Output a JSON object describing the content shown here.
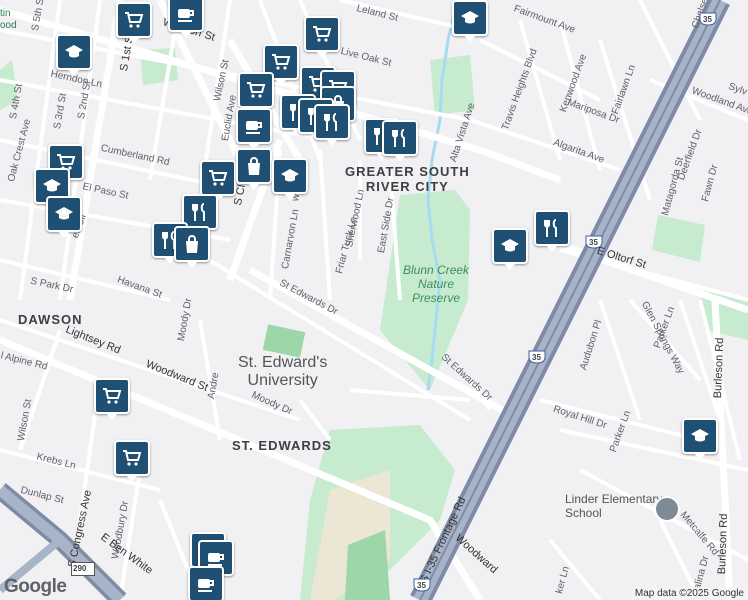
{
  "colors": {
    "land": "#f1f0f3",
    "park": "#c6ebcf",
    "water": "#a6dbf1",
    "road": "#ffffff",
    "highway": "#7d8ba6",
    "marker": "#1f4f72"
  },
  "areas": {
    "greater_south_river_city": "GREATER SOUTH\nRIVER CITY",
    "dawson": "DAWSON",
    "st_edwards": "ST. EDWARDS"
  },
  "park": "Blunn Creek\nNature\nPreserve",
  "university": "St. Edward's\nUniversity",
  "school": "Linder Elementary\nSchool",
  "partial_top_left": "tin\nood",
  "streets": {
    "w_oltorf": "W Oltorf St",
    "e_oltorf": "E Oltorf St",
    "s_1st": "S 1st St",
    "s_5th": "S 5th St",
    "s_4th": "S 4th St",
    "s_3rd": "S 3rd St",
    "s_2nd": "S 2nd St",
    "herndon": "Herndon Ln",
    "oak_crest": "Oak Crest Ave",
    "cumberland": "Cumberland Rd",
    "el_paso": "El Paso St",
    "wilson_top": "Wilson St",
    "euclid": "Euclid Ave",
    "leland": "Leland St",
    "live_oak": "Live Oak St",
    "fairmount": "Fairmount Ave",
    "travis_heights": "Travis Heights Blvd",
    "kenwood": "Kenwood Ave",
    "fairlawn": "Fairlawn Ln",
    "mariposa": "Mariposa Dr",
    "algarita": "Algarita Ave",
    "alta_vista": "Alta Vista Ave",
    "chelsea": "Chelse",
    "woodland": "Woodland Ave",
    "sylvan": "Sylv",
    "deerfield": "Deerfield Dr",
    "matagorda": "Matagorda St",
    "fawn": "Fawn Dr",
    "sherwood": "Sherwood Ln",
    "carnarvon": "Carnarvon Ln",
    "friar_tuck": "Friar Tuck Ln",
    "east_side": "East Side Dr",
    "st_edwards_dr": "St Edwards Dr",
    "st_edwards_dr2": "St Edwards Dr",
    "havana": "Havana St",
    "s_park": "S Park Dr",
    "lightsey": "Lightsey Rd",
    "woodward": "Woodward St",
    "alpine": "l Alpine Rd",
    "moody": "Moody Dr",
    "moody2": "Moody Dr",
    "andre": "Andre",
    "wilson": "Wilson St",
    "krebs": "Krebs Ln",
    "dunlap": "Dunlap St",
    "s_congress": "S Congress Ave",
    "woodbury": "Woodbury Dr",
    "ben_white": "E Ben White",
    "audubon": "Audubon Pl",
    "parker": "Parker Ln",
    "parker2": "Parker Ln",
    "glen_springs": "Glen Springs Way",
    "royal_hill": "Royal Hill Dr",
    "burleson": "Burleson Rd",
    "burleson2": "Burleson Rd",
    "frontage": "S I-35 Frontage Rd",
    "woodward2": "Woodward",
    "metcalfe": "Metcalfe Rd",
    "catalina": "alina Dr",
    "ker": "ker Ln",
    "ell_cir": "ell Cir",
    "cl_ave": "S Cl",
    "w_ave": "w Ln"
  },
  "highways": {
    "i35_a": "35",
    "i35_b": "35",
    "i35_c": "35",
    "i35_d": "35",
    "us290": "290"
  },
  "markers": [
    {
      "type": "grocery",
      "name": "grocery-marker"
    },
    {
      "type": "cafe",
      "name": "cafe-marker"
    },
    {
      "type": "grocery",
      "name": "grocery-marker"
    },
    {
      "type": "school",
      "name": "school-marker"
    },
    {
      "type": "school",
      "name": "school-marker"
    },
    {
      "type": "grocery",
      "name": "grocery-marker"
    },
    {
      "type": "restaurant",
      "name": "restaurant-marker"
    },
    {
      "type": "cafe",
      "name": "cafe-marker"
    },
    {
      "type": "shopping",
      "name": "shopping-marker"
    }
  ],
  "branding": {
    "logo": "Google",
    "attribution": "Map data ©2025 Google"
  }
}
